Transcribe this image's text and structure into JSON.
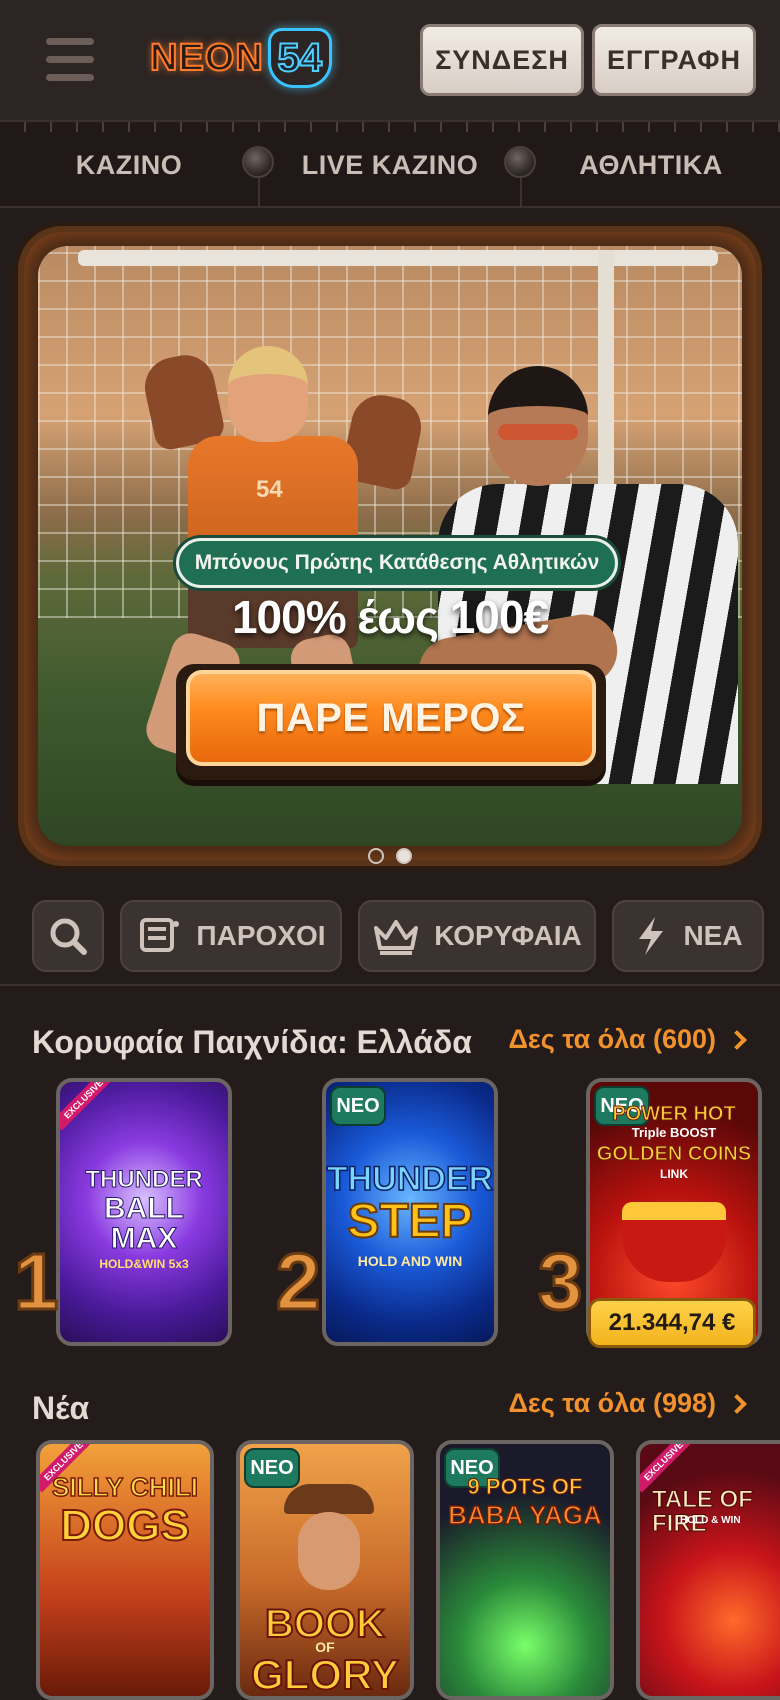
{
  "header": {
    "logo_word": "NEON",
    "logo_num": "54",
    "login_label": "ΣΥΝΔΕΣΗ",
    "register_label": "ΕΓΓΡΑΦΗ"
  },
  "nav": {
    "items": [
      {
        "label": "ΚΑΖΙΝΟ"
      },
      {
        "label": "LIVE ΚΑΖΙΝΟ"
      },
      {
        "label": "ΑΘΛΗΤΙΚΑ"
      }
    ]
  },
  "banner": {
    "jersey_number": "54",
    "tag": "Μπόνους Πρώτης Κατάθεσης Αθλητικών",
    "amount": "100% έως 100€",
    "cta_label": "ΠΑΡΕ ΜΕΡΟΣ",
    "slides_total": 2,
    "active_slide": 2
  },
  "filters": {
    "providers_label": "ΠΑΡΟΧΟΙ",
    "top_label": "ΚΟΡΥΦΑΙΑ",
    "new_label": "ΝΕΑ"
  },
  "top_games": {
    "title": "Κορυφαία Παιχνίδια: Ελλάδα",
    "see_all": "Δες τα όλα (600)",
    "games": [
      {
        "rank": "1",
        "name_line1": "THUNDER",
        "name_line2": "BALL",
        "name_line3": "MAX",
        "sub": "HOLD&WIN 5x3",
        "badge": "",
        "ribbon": "EXCLUSIVE"
      },
      {
        "rank": "2",
        "name_line1": "THUNDER",
        "name_line2": "STEP",
        "sub": "HOLD AND WIN",
        "badge": "ΝΕΟ"
      },
      {
        "rank": "3",
        "name_line1": "POWER HOT",
        "name_line2": "Triple BOOST",
        "name_line3": "GOLDEN COINS",
        "sub": "LINK",
        "badge": "ΝΕΟ",
        "jackpot": "21.344,74 €"
      }
    ]
  },
  "new_games": {
    "title": "Νέα",
    "see_all": "Δες τα όλα (998)",
    "games": [
      {
        "name_line1": "SILLY CHILI",
        "name_line2": "DOGS",
        "badge": "",
        "ribbon": "EXCLUSIVE"
      },
      {
        "name_line1": "BOOK",
        "name_line2": "OF",
        "name_line3": "GLORY",
        "badge": "ΝΕΟ"
      },
      {
        "name_line1": "9 POTS OF",
        "name_line2": "BABA YAGA",
        "badge": "ΝΕΟ"
      },
      {
        "name_line1": "TALE OF FIRE",
        "name_line2": "HOLD & WIN",
        "badge": "",
        "ribbon": "EXCLUSIVE"
      }
    ]
  },
  "colors": {
    "accent_orange": "#f2922e",
    "badge_green": "#1e7a5e",
    "background": "#231c1a"
  }
}
